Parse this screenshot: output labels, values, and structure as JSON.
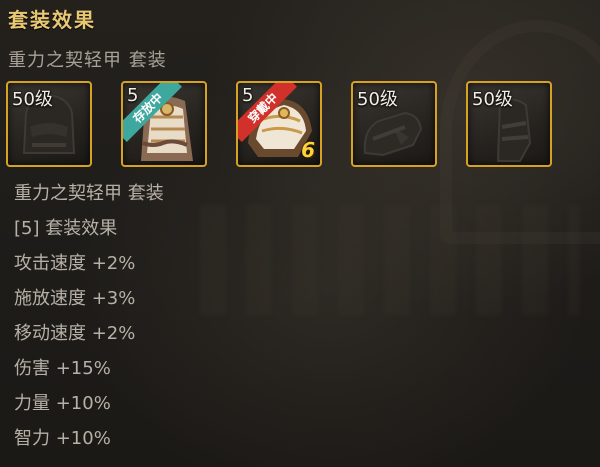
{
  "tooltip": {
    "title": "套装效果",
    "set_name": "重力之契轻甲 套装",
    "slots": [
      {
        "level_label": "50级",
        "state": "",
        "piece": "helmet-icon"
      },
      {
        "level_label": "5",
        "state": "存放中",
        "piece": "chest-armor-icon"
      },
      {
        "level_label": "5",
        "state": "穿戴中",
        "piece": "shoulder-armor-icon",
        "enhance": "6"
      },
      {
        "level_label": "50级",
        "state": "",
        "piece": "gauntlet-icon"
      },
      {
        "level_label": "50级",
        "state": "",
        "piece": "greave-icon"
      }
    ],
    "effect": {
      "set_name": "重力之契轻甲 套装",
      "tier": "[5] 套装效果",
      "stats": [
        "攻击速度 +2%",
        "施放速度 +3%",
        "移动速度 +2%",
        "伤害 +15%",
        "力量 +10%",
        "智力 +10%"
      ]
    },
    "colors": {
      "title": "#e8c872",
      "slot_border": "#d7a224",
      "text": "#b6b0a6",
      "stored_tag": "#3fa89e",
      "equipped_tag": "#d2302a",
      "enhance": "#ffd23a"
    }
  }
}
